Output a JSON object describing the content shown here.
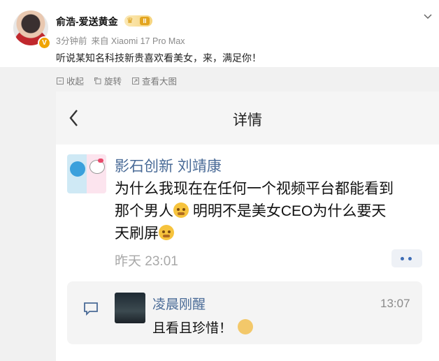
{
  "post": {
    "username": "俞浩-爱送黄金",
    "level_badge": "II",
    "time": "3分钟前",
    "source": "来自 Xiaomi 17 Pro Max",
    "text": "听说某知名科技新贵喜欢看美女，来，满足你！"
  },
  "actions": {
    "collapse": "收起",
    "rotate": "旋转",
    "view_large": "查看大图"
  },
  "screenshot": {
    "title": "详情",
    "comment": {
      "author": "影石创新 刘靖康",
      "line1": "为什么我现在在任何一个视频平台都能看到",
      "line2_a": "那个男人",
      "line2_b": " 明明不是美女CEO为什么要天",
      "line3": "天刷屏",
      "time": "昨天 23:01"
    },
    "reply": {
      "author": "凌晨刚醒",
      "time": "13:07",
      "text": "且看且珍惜！"
    }
  },
  "colors": {
    "link_blue": "#4a6b97",
    "gold": "#f0a400"
  }
}
